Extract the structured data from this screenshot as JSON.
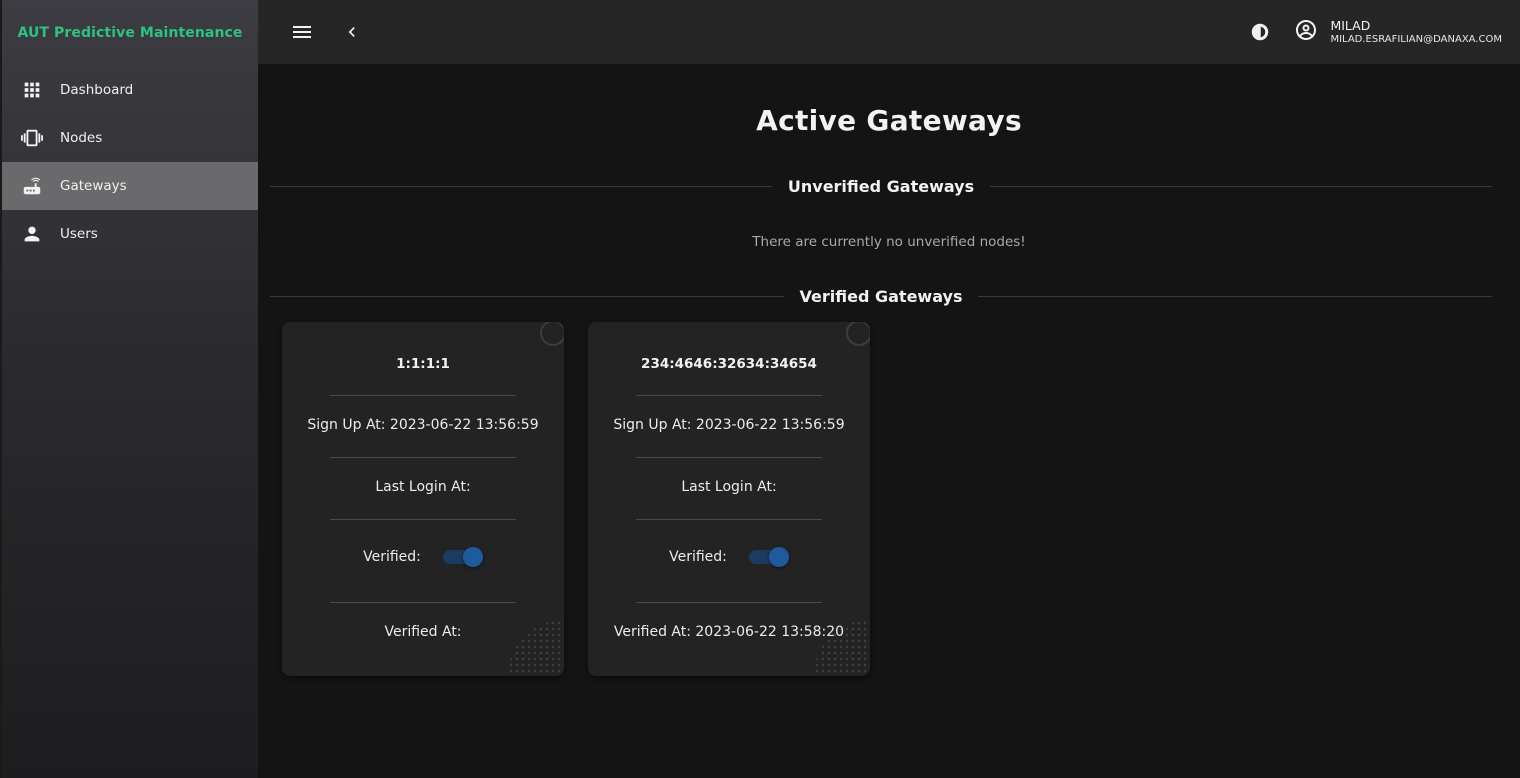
{
  "app": {
    "title": "AUT Predictive Maintenance"
  },
  "sidebar": {
    "items": [
      {
        "label": "Dashboard",
        "icon": "grid-icon",
        "active": false
      },
      {
        "label": "Nodes",
        "icon": "vibration-icon",
        "active": false
      },
      {
        "label": "Gateways",
        "icon": "router-icon",
        "active": true
      },
      {
        "label": "Users",
        "icon": "person-icon",
        "active": false
      }
    ]
  },
  "topbar": {
    "user": {
      "name": "MILAD",
      "email": "MILAD.ESRAFILIAN@DANAXA.COM"
    }
  },
  "main": {
    "title": "Active Gateways",
    "unverified_heading": "Unverified Gateways",
    "unverified_empty": "There are currently no unverified nodes!",
    "verified_heading": "Verified Gateways",
    "gateways": [
      {
        "id": "1:1:1:1",
        "signup": "Sign Up At: 2023-06-22 13:56:59",
        "last_login": "Last Login At:",
        "verified_label": "Verified:",
        "verified": true,
        "verified_at": "Verified At:"
      },
      {
        "id": "234:4646:32634:34654",
        "signup": "Sign Up At: 2023-06-22 13:56:59",
        "last_login": "Last Login At:",
        "verified_label": "Verified:",
        "verified": true,
        "verified_at": "Verified At: 2023-06-22 13:58:20"
      }
    ]
  },
  "colors": {
    "brand": "#2ec27e",
    "toggle_on": "#1e5a9c",
    "active_nav": "#6a6a6d"
  }
}
